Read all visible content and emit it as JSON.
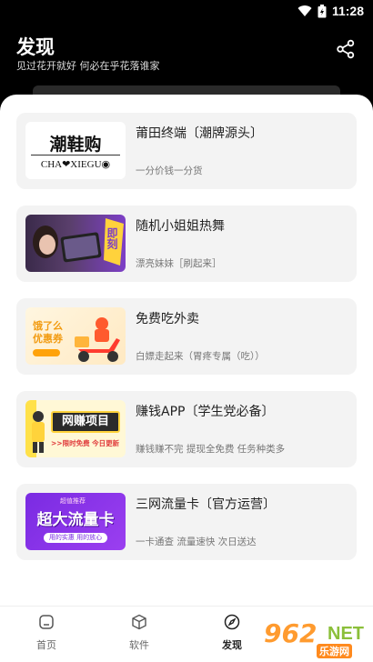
{
  "status": {
    "time": "11:28"
  },
  "header": {
    "title": "发现",
    "subtitle": "见过花开就好 何必在乎花落谁家"
  },
  "cards": [
    {
      "title": "莆田终端〔潮牌源头〕",
      "desc": "一分价钱一分货",
      "thumb_text": "潮鞋购",
      "thumb_sub": "CHA❤XIEGU◉"
    },
    {
      "title": "随机小姐姐热舞",
      "desc": "漂亮妹妹［刷起来］",
      "thumb_text": "即刻"
    },
    {
      "title": "免费吃外卖",
      "desc": "白嫖走起来（胃疼专属（吃））",
      "thumb_text": "饿了么 优惠券"
    },
    {
      "title": "赚钱APP〔学生党必备〕",
      "desc": "赚钱赚不完 提现全免费 任务种类多",
      "thumb_text": "网赚项目",
      "thumb_sub": ">>限时免费 今日更新"
    },
    {
      "title": "三网流量卡〔官方运营〕",
      "desc": "一卡通查 流量速快 次日送达",
      "thumb_text": "超大流量卡",
      "thumb_top": "超值推荐",
      "thumb_sub": "用的实惠 用的放心"
    }
  ],
  "tabs": [
    {
      "label": "首页",
      "icon": "home-icon"
    },
    {
      "label": "软件",
      "icon": "cube-icon"
    },
    {
      "label": "发现",
      "icon": "compass-icon"
    }
  ],
  "watermark": {
    "num": "962",
    "net": "NET",
    "cn": "乐游网"
  },
  "colors": {
    "accent": "#ff9b2f",
    "purple": "#8a2be2"
  }
}
